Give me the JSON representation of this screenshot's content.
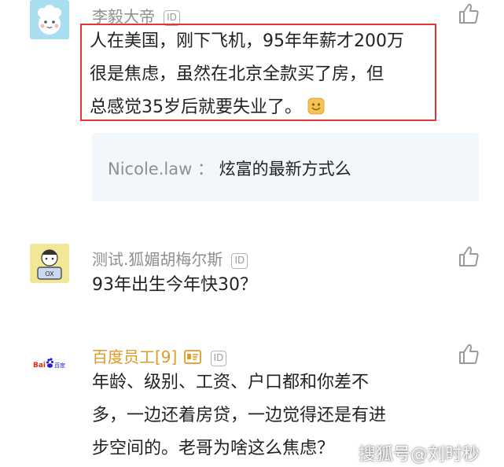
{
  "comments": [
    {
      "username": "李毅大帝",
      "id_badge": "ID",
      "text_lines": [
        "人在美国，刚下飞机，95年年薪才200万",
        "很是焦虑，虽然在北京全款买了房，但",
        "总感觉35岁后就要失业了。"
      ],
      "emoji": "smile-emoji",
      "reply": {
        "author": "Nicole.law",
        "separator": "：",
        "text": "炫富的最新方式么"
      }
    },
    {
      "username": "测试.狐媚胡梅尔斯",
      "id_badge": "ID",
      "text_lines": [
        "93年出生今年快30？"
      ]
    },
    {
      "username": "百度员工[9]",
      "id_badge": "ID",
      "avatar_brand": {
        "text1": "Bai",
        "text2": "百度"
      },
      "text_lines": [
        "年龄、级别、工资、户口都和你差不",
        "多，一边还着房贷，一边觉得还是有进",
        "步空间的。老哥为啥这么焦虑？"
      ]
    }
  ],
  "watermark": "搜狐号@刘时秒",
  "colors": {
    "highlight_border": "#e03636",
    "reply_bg": "#f2f7fb",
    "gold_name": "#e09a24"
  }
}
